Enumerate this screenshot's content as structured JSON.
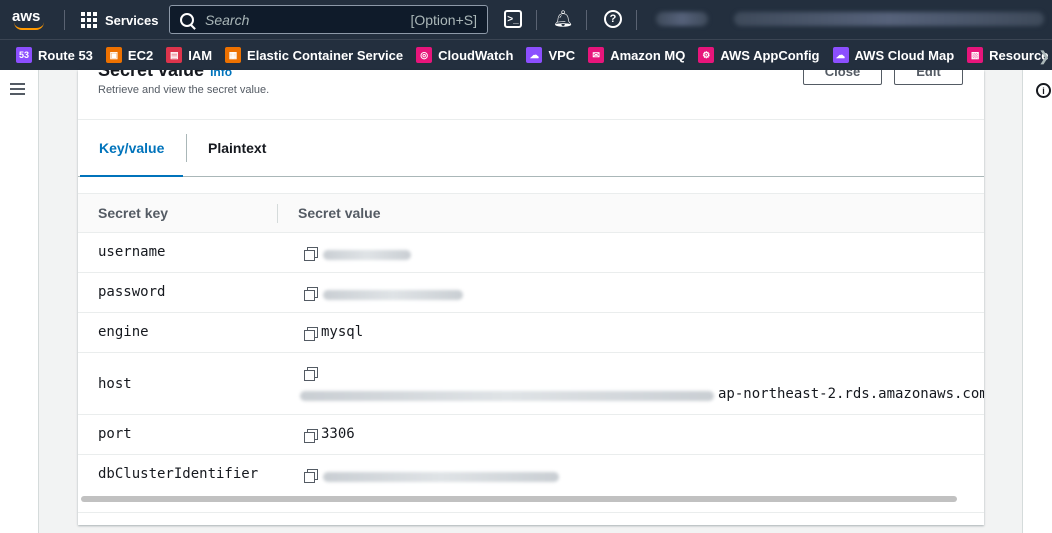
{
  "topnav": {
    "logo_text": "aws",
    "services_label": "Services",
    "search_placeholder": "Search",
    "search_shortcut": "[Option+S]"
  },
  "favorites": [
    {
      "label": "Route 53",
      "icon": "route53-icon",
      "color": "#8c4fff"
    },
    {
      "label": "EC2",
      "icon": "ec2-icon",
      "color": "#ed7100"
    },
    {
      "label": "IAM",
      "icon": "iam-icon",
      "color": "#dd344c"
    },
    {
      "label": "Elastic Container Service",
      "icon": "ecs-icon",
      "color": "#ed7100"
    },
    {
      "label": "CloudWatch",
      "icon": "cloudwatch-icon",
      "color": "#e7157b"
    },
    {
      "label": "VPC",
      "icon": "vpc-icon",
      "color": "#8c4fff"
    },
    {
      "label": "Amazon MQ",
      "icon": "amazonmq-icon",
      "color": "#e7157b"
    },
    {
      "label": "AWS AppConfig",
      "icon": "appconfig-icon",
      "color": "#e7157b"
    },
    {
      "label": "AWS Cloud Map",
      "icon": "cloudmap-icon",
      "color": "#8c4fff"
    },
    {
      "label": "Resource Groups",
      "icon": "resourcegroups-icon",
      "color": "#e7157b"
    }
  ],
  "panel": {
    "title": "Secret value",
    "info_link": "Info",
    "description": "Retrieve and view the secret value.",
    "close_button": "Close",
    "edit_button": "Edit"
  },
  "tabs": [
    {
      "label": "Key/value",
      "active": true
    },
    {
      "label": "Plaintext",
      "active": false
    }
  ],
  "table": {
    "headers": [
      "Secret key",
      "Secret value"
    ],
    "rows": [
      {
        "key": "username",
        "value": "",
        "redacted": true
      },
      {
        "key": "password",
        "value": "",
        "redacted": true
      },
      {
        "key": "engine",
        "value": "mysql",
        "redacted": false
      },
      {
        "key": "host",
        "value": "ap-northeast-2.rds.amazonaws.com",
        "redacted": true
      },
      {
        "key": "port",
        "value": "3306",
        "redacted": false
      },
      {
        "key": "dbClusterIdentifier",
        "value": "",
        "redacted": true
      }
    ]
  },
  "colors": {
    "nav_bg": "#232f3e",
    "accent_link": "#0073bb",
    "brand_orange": "#ff9900"
  }
}
